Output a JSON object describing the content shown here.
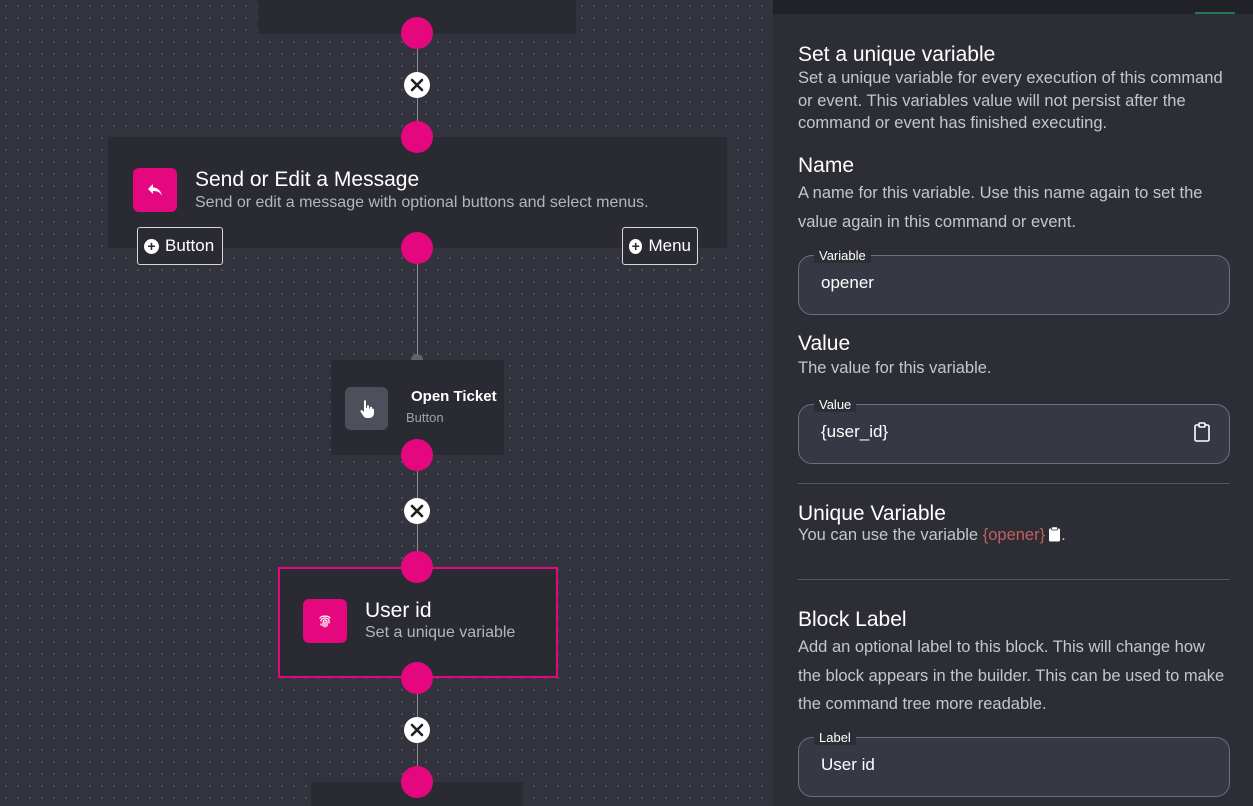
{
  "canvas": {
    "message_block": {
      "title": "Send or Edit a Message",
      "subtitle": "Send or edit a message with optional buttons and select menus.",
      "icon": "reply-icon",
      "button_chip": "Button",
      "menu_chip": "Menu"
    },
    "button_block": {
      "title": "Open Ticket",
      "subtitle": "Button",
      "icon": "pointer-hand-icon"
    },
    "variable_block": {
      "title": "User id",
      "subtitle": "Set a unique variable",
      "icon": "fingerprint-icon"
    },
    "accent_color": "#e5077e"
  },
  "panel": {
    "header": {
      "title": "Set a unique variable",
      "description": "Set a unique variable for every execution of this command or event. This variables value will not persist after the command or event has finished executing."
    },
    "name_section": {
      "title": "Name",
      "description": "A name for this variable. Use this name again to set the value again in this command or event.",
      "field_label": "Variable",
      "field_value": "opener"
    },
    "value_section": {
      "title": "Value",
      "description": "The value for this variable.",
      "field_label": "Value",
      "field_value": "{user_id}",
      "icon": "clipboard-icon"
    },
    "unique_section": {
      "title": "Unique Variable",
      "description_prefix": "You can use the variable",
      "variable_token": "{opener}",
      "description_suffix": "."
    },
    "label_section": {
      "title": "Block Label",
      "description": "Add an optional label to this block. This will change how the block appears in the builder. This can be used to make the command tree more readable.",
      "field_label": "Label",
      "field_value": "User id"
    }
  }
}
